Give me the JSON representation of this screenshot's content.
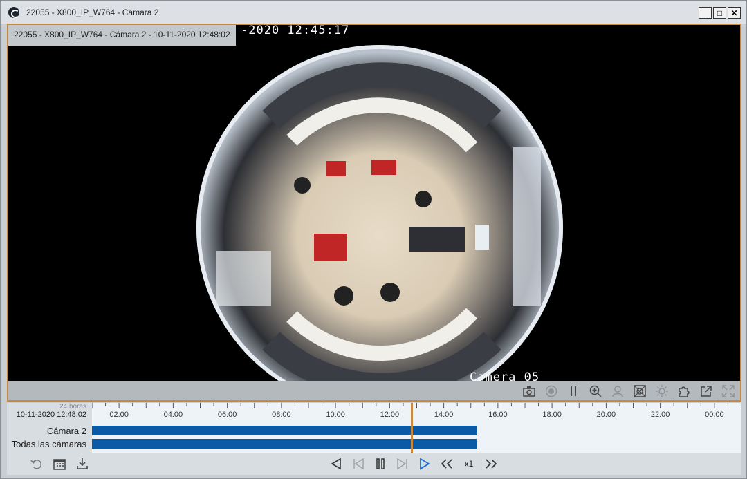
{
  "window": {
    "title": "22055 - X800_IP_W764 - Cámara 2",
    "buttons": {
      "minimize": "_",
      "maximize": "□",
      "close": "✕"
    }
  },
  "video": {
    "label": "22055 - X800_IP_W764 - Cámara 2 - 10-11-2020 12:48:02",
    "osd_timestamp": "-2020 12:45:17",
    "osd_camera": "Camera 05"
  },
  "toolbar": {
    "icons": [
      "camera-icon",
      "record-icon",
      "pause-icon",
      "zoom-in-icon",
      "user-icon",
      "fisheye-icon",
      "brightness-icon",
      "puzzle-icon",
      "external-window-icon",
      "fullscreen-icon"
    ]
  },
  "timeline": {
    "range_label": "24 horas",
    "current_datetime": "10-11-2020 12:48:02",
    "ticks": [
      "02:00",
      "04:00",
      "06:00",
      "08:00",
      "10:00",
      "12:00",
      "14:00",
      "16:00",
      "18:00",
      "20:00",
      "22:00",
      "00:00"
    ],
    "playhead_hour": 12.8,
    "rows": [
      {
        "label": "Cámara 2",
        "recording_end_hour": 15.2
      },
      {
        "label": "Todas las cámaras",
        "recording_end_hour": 15.2
      }
    ],
    "left_icons": [
      "undo-icon",
      "calendar-icon",
      "download-icon"
    ]
  },
  "playback": {
    "speed": "x1",
    "controls": [
      "play-reverse-icon",
      "step-back-icon",
      "pause-icon",
      "step-forward-icon",
      "play-icon",
      "rewind-icon",
      "fast-forward-icon"
    ]
  },
  "colors": {
    "accent": "#c8893f",
    "recording_bar": "#0b5aa6",
    "play_active": "#1a6fd1"
  }
}
